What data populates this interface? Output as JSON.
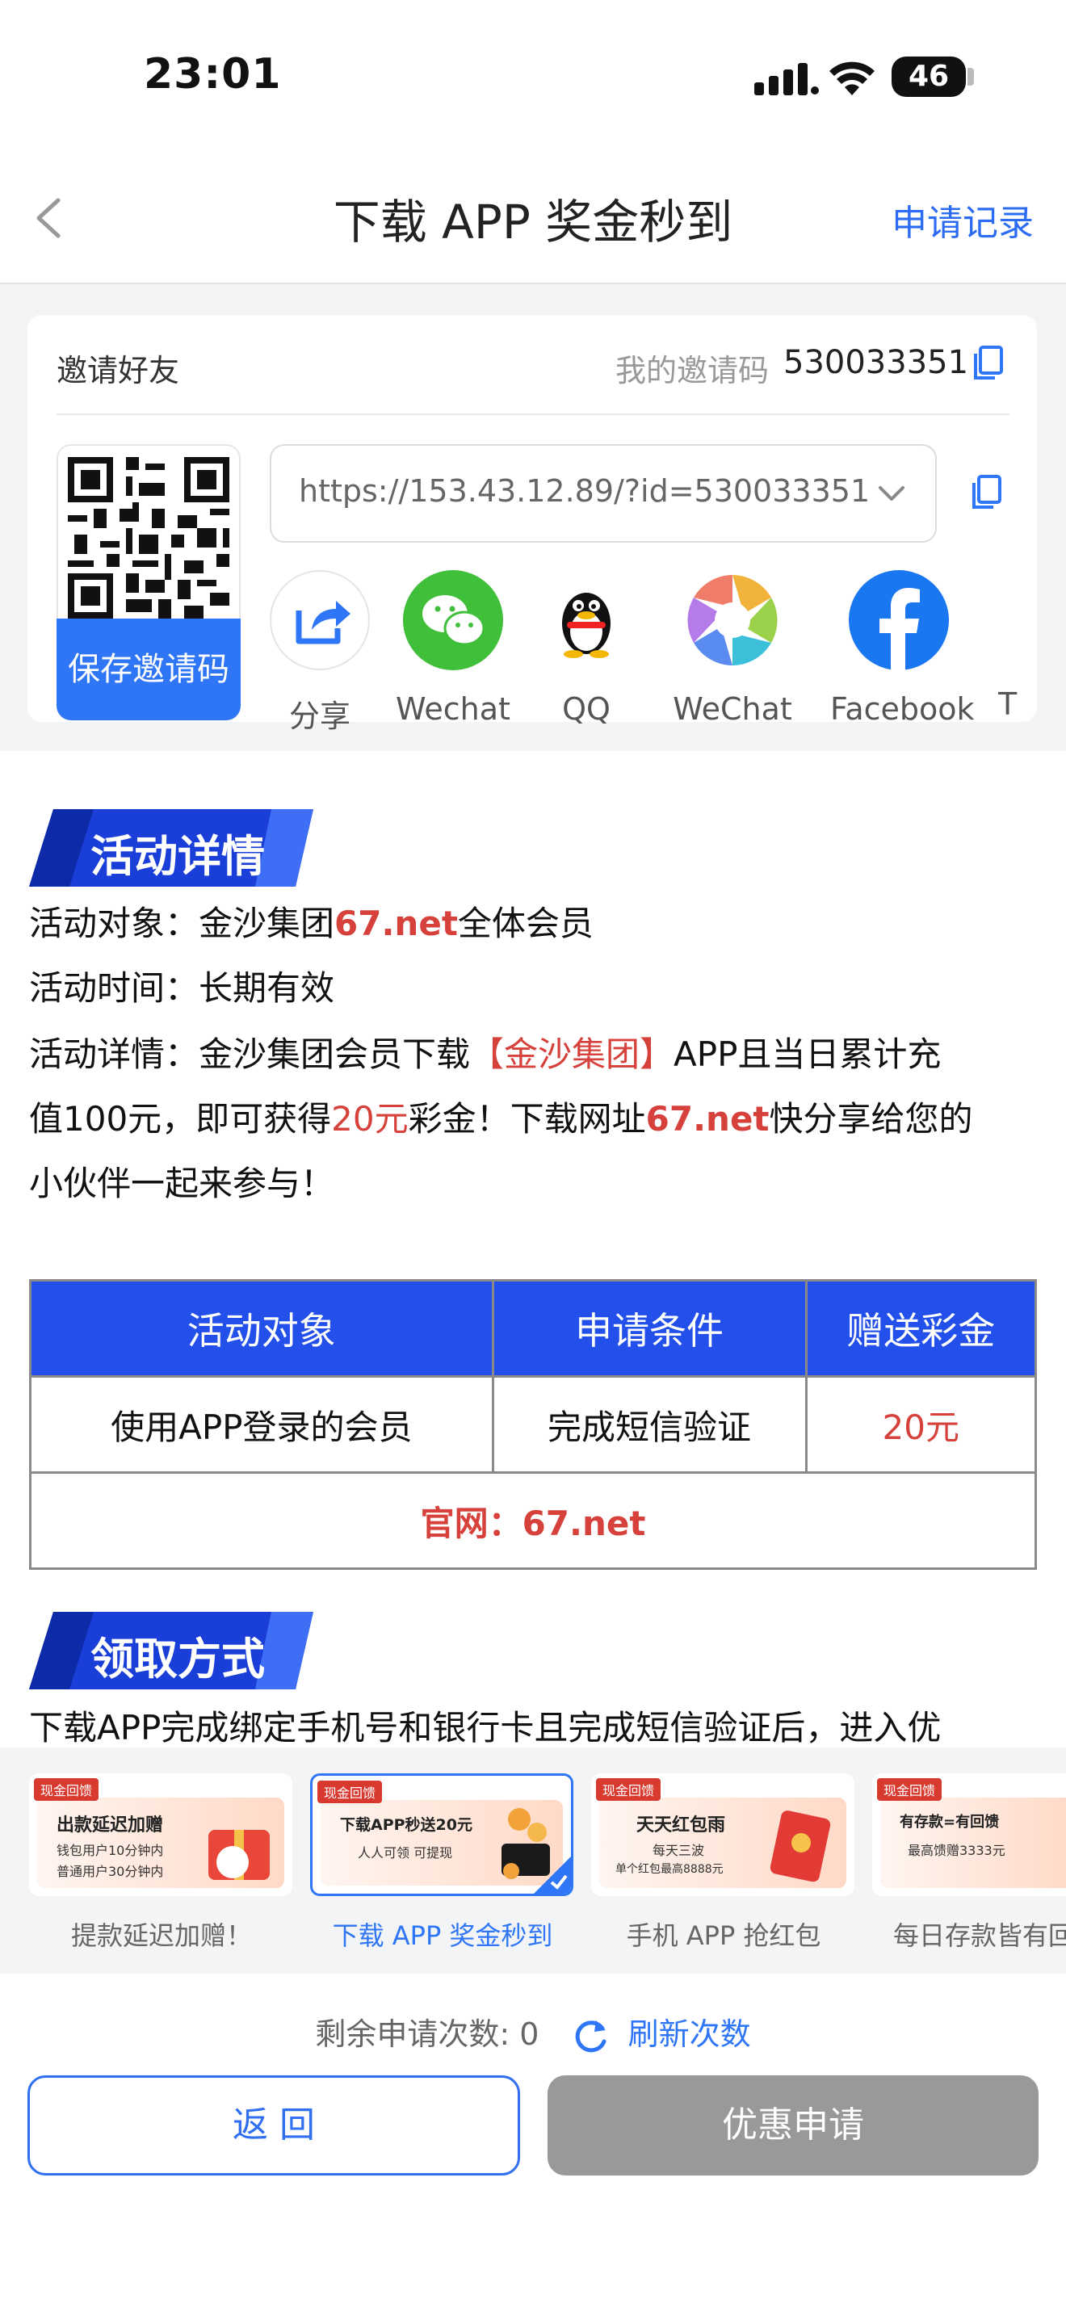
{
  "status": {
    "time": "23:01",
    "battery": "46"
  },
  "nav": {
    "title": "下载 APP 奖金秒到",
    "right_link": "申请记录"
  },
  "invite": {
    "label": "邀请好友",
    "code_label": "我的邀请码",
    "code": "530033351",
    "save_qr": "保存邀请码",
    "url": "https://153.43.12.89/?id=530033351",
    "share": [
      {
        "label": "分享",
        "icon": "share-arrow-icon"
      },
      {
        "label": "Wechat",
        "icon": "wechat-icon"
      },
      {
        "label": "QQ",
        "icon": "qq-penguin-icon"
      },
      {
        "label": "WeChat",
        "icon": "wechat-moments-icon"
      },
      {
        "label": "Facebook",
        "icon": "facebook-icon"
      },
      {
        "label": "T",
        "icon": "partial-icon"
      }
    ]
  },
  "details": {
    "section_title": "活动详情",
    "target_label": "活动对象：",
    "target_prefix": "金沙集团",
    "target_link": "67.net",
    "target_suffix": "全体会员",
    "time_label": "活动时间：",
    "time_value": "长期有效",
    "detail_label": "活动详情：",
    "detail_a": "金沙集团会员下载",
    "detail_brand": "【金沙集团】",
    "detail_b": "APP且当日累计充",
    "detail_c": "值100元，即可获得",
    "detail_amount": "20元",
    "detail_d": "彩金！下载网址",
    "detail_link": "67.net",
    "detail_e": "快分享给您的",
    "detail_f": "小伙伴一起来参与！"
  },
  "table": {
    "headers": [
      "活动对象",
      "申请条件",
      "赠送彩金"
    ],
    "row": [
      "使用APP登录的会员",
      "完成短信验证",
      "20元"
    ],
    "footer": "官网：67.net"
  },
  "claim": {
    "section_title": "领取方式",
    "text": "下载APP完成绑定手机号和银行卡且完成短信验证后，进入优"
  },
  "promos": [
    {
      "tag": "现金回馈",
      "line1": "出款延迟加赠",
      "line2": "钱包用户10分钟内",
      "line3": "普通用户30分钟内",
      "label": "提款延迟加赠！"
    },
    {
      "tag": "现金回馈",
      "line1": "下载APP秒送20元",
      "line2": "人人可领 可提现",
      "line3": "",
      "label": "下载 APP 奖金秒到"
    },
    {
      "tag": "现金回馈",
      "line1": "天天红包雨",
      "line2": "每天三波",
      "line3": "单个红包最高8888元",
      "label": "手机 APP 抢红包"
    },
    {
      "tag": "现金回馈",
      "line1": "有存款=有回馈",
      "line2": "最高馈赠3333元",
      "line3": "",
      "label": "每日存款皆有回"
    }
  ],
  "footer": {
    "remain_label": "剩余申请次数:",
    "remain_count": "0",
    "refresh": "刷新次数",
    "back_button": "返 回",
    "apply_button": "优惠申请"
  },
  "colors": {
    "accent": "#2f76f6",
    "header_blue": "#2350ea",
    "red": "#d7413b",
    "disabled": "#999999"
  }
}
